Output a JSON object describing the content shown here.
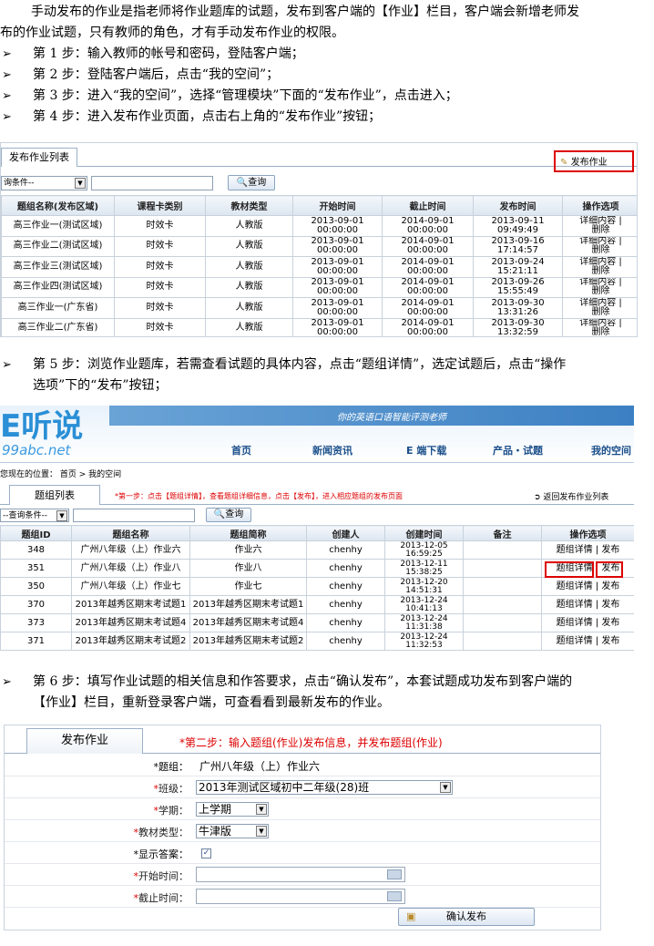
{
  "intro": {
    "line1": "手动发布的作业是指老师将作业题库的试题，发布到客户端的【作业】栏目，客户端会新增老师发",
    "line2": "布的作业试题，只有教师的角色，才有手动发布作业的权限。"
  },
  "steps": [
    {
      "label": "第 1 步：",
      "text": "输入教师的帐号和密码，登陆客户端；"
    },
    {
      "label": "第 2 步：",
      "text": "登陆客户端后，点击“我的空间”；"
    },
    {
      "label": "第 3 步：",
      "text": "进入“我的空间”，选择“管理模块”下面的“发布作业”，点击进入；"
    },
    {
      "label": "第 4 步：",
      "text": "进入发布作业页面，点击右上角的“发布作业”按钮；"
    },
    {
      "label": "第 5 步：",
      "text": "浏览作业题库，若需查看试题的具体内容，点击“题组详情”，选定试题后，点击“操作",
      "text2": "选项”下的“发布”按钮；"
    },
    {
      "label": "第 6 步：",
      "text": "填写作业试题的相关信息和作答要求，点击“确认发布”，本套试题成功发布到客户端的",
      "text2": "【作业】栏目，重新登录客户端，可查看看到最新发布的作业。"
    }
  ],
  "arrow": "➢",
  "shot1": {
    "tab": "发布作业列表",
    "publish_btn": "发布作业",
    "select": "询条件--",
    "query": "查询",
    "headers": [
      "题组名称(发布区域)",
      "课程卡类别",
      "教材类型",
      "开始时间",
      "截止时间",
      "发布时间",
      "操作选项"
    ],
    "rows": [
      [
        "高三作业一(测试区域)",
        "时效卡",
        "人教版",
        "2013-09-01",
        "00:00:00",
        "2014-09-01",
        "00:00:00",
        "2013-09-11",
        "09:49:49",
        "详细内容 |",
        "删除"
      ],
      [
        "高三作业二(测试区域)",
        "时效卡",
        "人教版",
        "2013-09-01",
        "00:00:00",
        "2014-09-01",
        "00:00:00",
        "2013-09-16",
        "17:14:57",
        "详细内容 |",
        "删除"
      ],
      [
        "高三作业三(测试区域)",
        "时效卡",
        "人教版",
        "2013-09-01",
        "00:00:00",
        "2014-09-01",
        "00:00:00",
        "2013-09-24",
        "15:21:11",
        "详细内容 |",
        "删除"
      ],
      [
        "高三作业四(测试区域)",
        "时效卡",
        "人教版",
        "2013-09-01",
        "00:00:00",
        "2014-09-01",
        "00:00:00",
        "2013-09-26",
        "15:55:49",
        "详细内容 |",
        "删除"
      ],
      [
        "高三作业一(广东省)",
        "时效卡",
        "人教版",
        "2013-09-01",
        "00:00:00",
        "2014-09-01",
        "00:00:00",
        "2013-09-30",
        "13:31:26",
        "详细内容 |",
        "删除"
      ],
      [
        "高三作业二(广东省)",
        "时效卡",
        "人教版",
        "2013-09-01",
        "00:00:00",
        "2014-09-01",
        "00:00:00",
        "2013-09-30",
        "13:32:59",
        "详细内容 |",
        "删除"
      ]
    ]
  },
  "shot2": {
    "logo_main": "E听说",
    "logo_sub": "99abc.net",
    "slogan": "你的英语口语智能评测老师",
    "nav": [
      "首页",
      "新闻资讯",
      "E 端下载",
      "产品・试题",
      "我的空间"
    ],
    "breadcrumb": "您现在的位置： 首页 > 我的空间",
    "tab": "题组列表",
    "hint": "*第一步：点击【题组详情】，查看题组详细信息，点击【发布】，进入相应题组的发布页面",
    "back": "返回发布作业列表",
    "select": "--查询条件--",
    "query": "查询",
    "headers": [
      "题组ID",
      "题组名称",
      "题组简称",
      "创建人",
      "创建时间",
      "备注",
      "操作选项"
    ],
    "rows": [
      [
        "348",
        "广州八年级（上）作业六",
        "作业六",
        "chenhy",
        "2013-12-05",
        "16:59:25",
        "",
        "题组详情 | 发布"
      ],
      [
        "351",
        "广州八年级（上）作业八",
        "作业八",
        "chenhy",
        "2013-12-11",
        "15:38:25",
        "",
        "题组详情 | 发布"
      ],
      [
        "350",
        "广州八年级（上）作业七",
        "作业七",
        "chenhy",
        "2013-12-20",
        "14:51:31",
        "",
        "题组详情 | 发布"
      ],
      [
        "370",
        "2013年越秀区期末考试题1",
        "2013年越秀区期末考试题1",
        "chenhy",
        "2013-12-24",
        "10:41:13",
        "",
        "题组详情 | 发布"
      ],
      [
        "373",
        "2013年越秀区期末考试题4",
        "2013年越秀区期末考试题4",
        "chenhy",
        "2013-12-24",
        "11:31:38",
        "",
        "题组详情 | 发布"
      ],
      [
        "371",
        "2013年越秀区期末考试题2",
        "2013年越秀区期末考试题2",
        "chenhy",
        "2013-12-24",
        "11:32:53",
        "",
        "题组详情 | 发布"
      ]
    ],
    "detail": "题组详情",
    "publish": "发布"
  },
  "shot3": {
    "tab": "发布作业",
    "hint": "*第二步：输入题组(作业)发布信息，并发布题组(作业)",
    "fields": [
      {
        "label": "*题组：",
        "value": "广州八年级（上）作业六"
      },
      {
        "label": "*班级：",
        "value": "2013年测试区域初中二年级(28)班"
      },
      {
        "label": "*学期：",
        "value": "上学期"
      },
      {
        "label": "*教材类型：",
        "value": "牛津版"
      },
      {
        "label": "*显示答案：",
        "value": ""
      },
      {
        "label": "*开始时间：",
        "value": ""
      },
      {
        "label": "*截止时间：",
        "value": ""
      }
    ],
    "confirm": "确认发布"
  }
}
